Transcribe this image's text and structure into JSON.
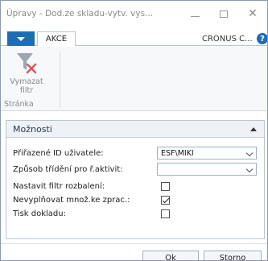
{
  "window": {
    "title": "Úpravy - Dod.ze skladu-vytv. vys...",
    "minimize_icon": "minimize-icon",
    "maximize_icon": "maximize-icon",
    "close_icon": "close-icon"
  },
  "tabs": {
    "app_menu_icon": "triangle-down-icon",
    "active_tab": "AKCE",
    "company": "CRONUS C...",
    "help_icon": "help-icon"
  },
  "ribbon": {
    "clear_filter_label": "Vymazat\nfiltr",
    "clear_filter_icon": "clear-filter-icon",
    "group_label": "Stránka"
  },
  "options": {
    "title": "Možnosti",
    "fields": [
      {
        "label": "Přiřazené ID uživatele:",
        "type": "select",
        "value": "ESF\\MIKI"
      },
      {
        "label": "Způsob třídění pro ř.aktivit:",
        "type": "select",
        "value": ""
      },
      {
        "label": "Nastavit filtr rozbalení:",
        "type": "checkbox",
        "checked": false
      },
      {
        "label": "Nevyplňovat množ.ke zprac.:",
        "type": "checkbox",
        "checked": true
      },
      {
        "label": "Tisk dokladu:",
        "type": "checkbox",
        "checked": false
      }
    ]
  },
  "buttons": {
    "ok": "Ok",
    "cancel": "Storno"
  },
  "colors": {
    "accent": "#1c6db6",
    "clear_filter_x": "#e05656",
    "funnel": "#9aa7b5"
  }
}
